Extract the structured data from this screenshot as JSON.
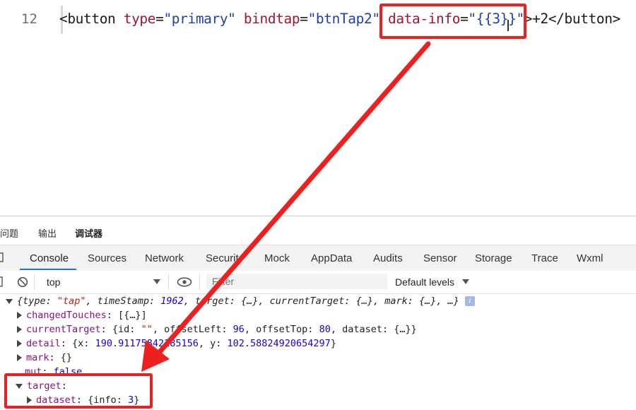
{
  "editor": {
    "line_number": "12",
    "code": {
      "open_bracket": "<",
      "tag": "button",
      "attr_type": "type",
      "val_type": "\"primary\"",
      "attr_bind": "bindtap",
      "val_bind": "\"btnTap2\"",
      "attr_data": "data-info",
      "val_data": "\"{{3}}\"",
      "close_open": ">",
      "inner": "+2",
      "close_tag": "</button>"
    }
  },
  "devtools": {
    "panel_tabs": [
      "问题",
      "输出",
      "调试器"
    ],
    "tool_tabs": [
      "Console",
      "Sources",
      "Network",
      "Securit",
      "Mock",
      "AppData",
      "Audits",
      "Sensor",
      "Storage",
      "Trace",
      "Wxml"
    ],
    "toolbar": {
      "context": "top",
      "filter_placeholder": "Filter",
      "levels": "Default levels"
    }
  },
  "console": {
    "event_line": {
      "p1": "{type: ",
      "type_val": "\"tap\"",
      "p2": ", timeStamp: ",
      "ts_val": "1962",
      "p3": ", target: {…}, currentTarget: {…}, mark: {…}, …}",
      "badge": "i"
    },
    "changed_touches": {
      "key": "changedTouches",
      "value": ": [{…}]"
    },
    "current_target": {
      "key": "currentTarget",
      "p1": ": {id: ",
      "id_val": "\"\"",
      "p2": ", offsetLeft: ",
      "ol_val": "96",
      "p3": ", offsetTop: ",
      "ot_val": "80",
      "p4": ", dataset: {…}}"
    },
    "detail": {
      "key": "detail",
      "p1": ": {x: ",
      "x_val": "190.91175842185156",
      "p2": ", y: ",
      "y_val": "102.58824920654297",
      "p3": "}"
    },
    "mark": {
      "key": "mark",
      "value": ": {}"
    },
    "mut": {
      "key": "mut",
      "p1": ": ",
      "value": "false"
    },
    "target": {
      "key": "target",
      "value": ":"
    },
    "dataset": {
      "key": "dataset",
      "p1": ": {info: ",
      "info_val": "3",
      "p2": "}"
    }
  },
  "colors": {
    "highlight": "#ee1f1f",
    "accent": "#1a73e8"
  }
}
